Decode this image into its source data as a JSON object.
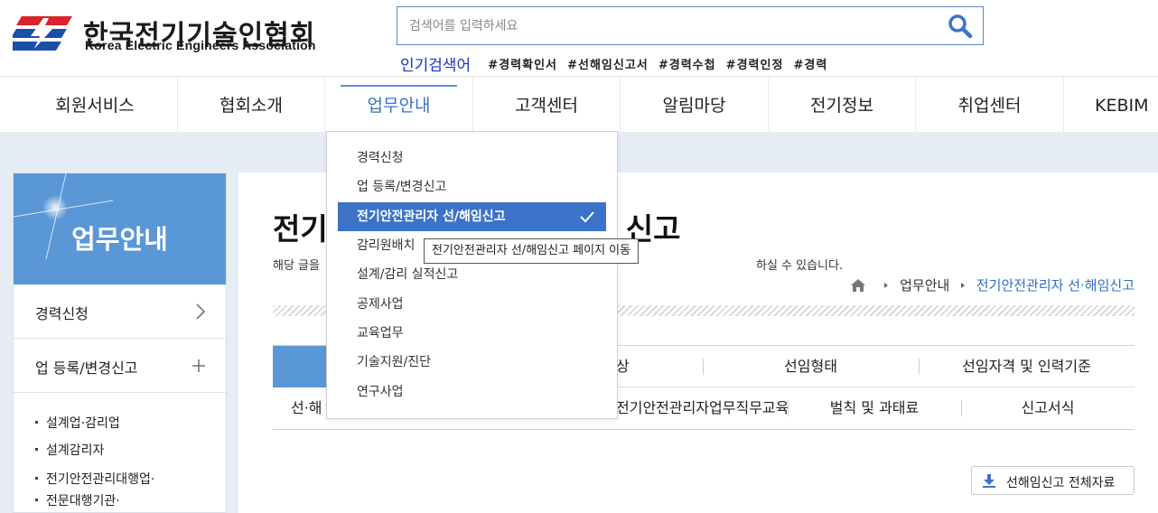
{
  "header": {
    "logo_ko": "한국전기기술인협회",
    "logo_en": "Korea Electric Engineers Association",
    "search_placeholder": "검색어를 입력하세요",
    "search_value": "",
    "popular_title": "인기검색어",
    "popular_tags": [
      "#경력확인서",
      "#선해임신고서",
      "#경력수첩",
      "#경력인정",
      "#경력"
    ]
  },
  "gnb": {
    "items": [
      "회원서비스",
      "협회소개",
      "업무안내",
      "고객센터",
      "알림마당",
      "전기정보",
      "취업센터",
      "KEBIM"
    ],
    "active": "업무안내"
  },
  "lnb": {
    "title": "업무안내",
    "items": [
      {
        "label": "경력신청",
        "symbol": "›"
      },
      {
        "label": "업 등록/변경신고",
        "symbol": "+"
      }
    ],
    "subitems": [
      "설계업·감리업",
      "설계감리자",
      "전기안전관리대행업·",
      "전문대행기관·"
    ]
  },
  "main": {
    "title_left": "전기",
    "title_right": "신고",
    "desc_left": "해당 글을",
    "desc_right": "하실 수 있습니다.",
    "breadcrumb": [
      "업무안내",
      "전기안전관리자 선·해임신고"
    ],
    "tabs_row1": [
      "",
      "상",
      "선임형태",
      "선임자격 및 인력기준"
    ],
    "tabs_row2": [
      "선·해",
      "전기안전관리자업무직무교육",
      "벌칙 및 과태료",
      "신고서식"
    ],
    "download_label": "선해임신고 전체자료"
  },
  "dropdown": {
    "items": [
      "경력신청",
      "업 등록/변경신고",
      "전기안전관리자 선/해임신고",
      "감리원배치",
      "설계/감리 실적신고",
      "공제사업",
      "교육업무",
      "기술지원/진단",
      "연구사업"
    ],
    "selected_index": 2,
    "tooltip": "전기안전관리자 선/해임신고 페이지 이동"
  },
  "colors": {
    "accent": "#3c73c8",
    "lnb_head": "#5a97d7",
    "content_bg": "#e6ecf3",
    "popular_title": "#1a33c8",
    "logo_red": "#d9232d",
    "logo_blue": "#1b4fa8"
  }
}
